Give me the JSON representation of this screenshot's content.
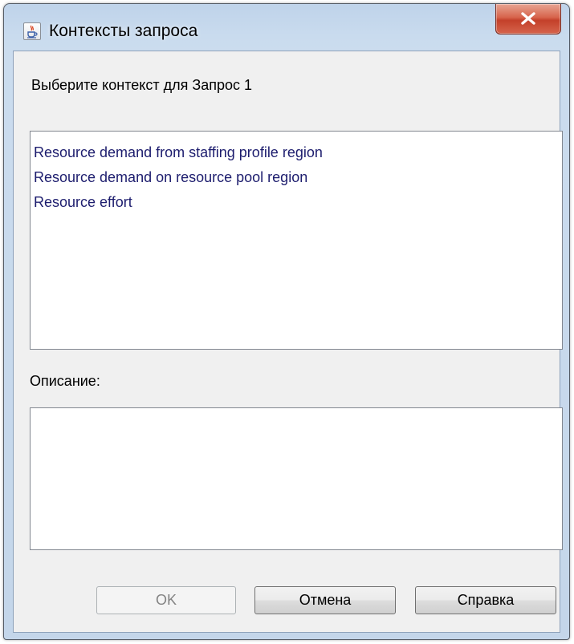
{
  "window": {
    "title": "Контексты запроса",
    "title_icon": "java-cup-icon",
    "close_icon": "close-x-icon"
  },
  "dialog": {
    "prompt": "Выберите контекст для Запрос 1",
    "contexts": [
      {
        "label": "Resource demand from staffing profile region"
      },
      {
        "label": "Resource demand on resource pool region"
      },
      {
        "label": "Resource effort"
      }
    ],
    "description_label": "Описание:",
    "description_value": ""
  },
  "buttons": {
    "ok": {
      "label": "OK",
      "enabled": false
    },
    "cancel": {
      "label": "Отмена",
      "enabled": true
    },
    "help": {
      "label": "Справка",
      "enabled": true
    }
  },
  "colors": {
    "close_button": "#d24f38",
    "list_text": "#1d1d6e",
    "disabled_text": "#838383"
  }
}
